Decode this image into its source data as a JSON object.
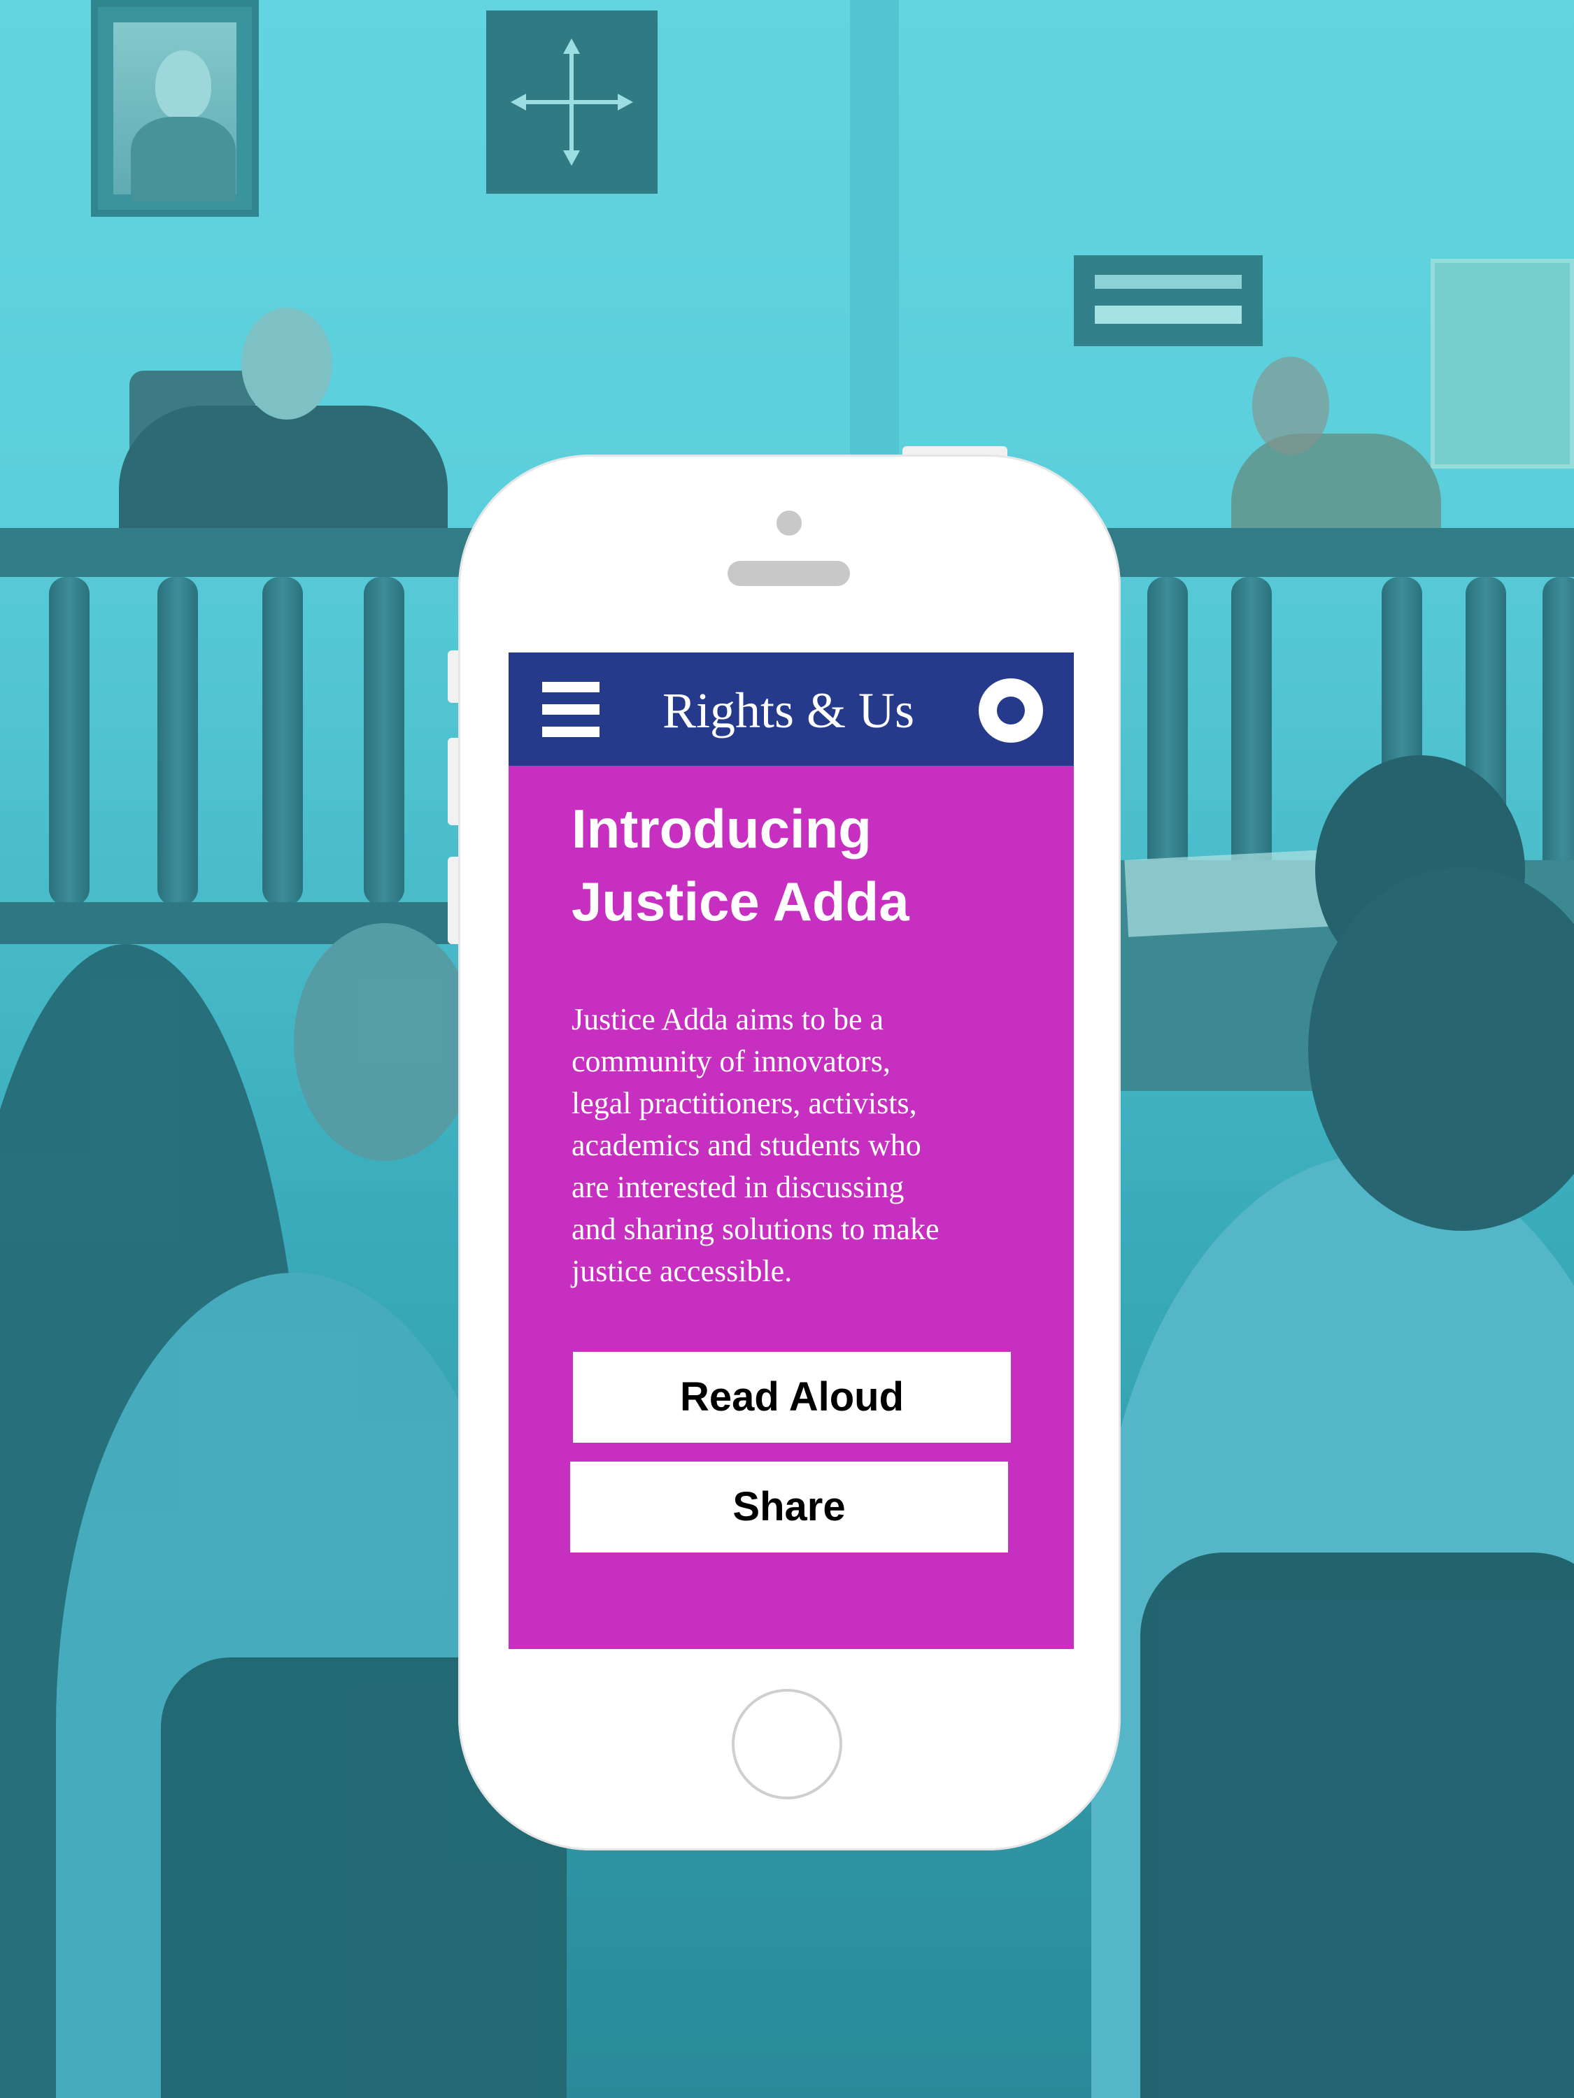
{
  "app": {
    "title": "Rights & Us"
  },
  "header": {
    "menu_icon": "hamburger-menu-icon",
    "action_icon": "record-ring-icon"
  },
  "article": {
    "title_line1": "Introducing",
    "title_line2": "Justice Adda",
    "body_lines": [
      "Justice Adda aims to be a",
      "community of innovators,",
      "legal practitioners, activists,",
      "academics and students who",
      "are interested in discussing",
      "and sharing solutions to make",
      "justice accessible."
    ]
  },
  "actions": {
    "read_aloud_label": "Read Aloud",
    "share_label": "Share"
  },
  "colors": {
    "header_bg": "#263a8c",
    "screen_bg": "#c62fbf",
    "background_tint": "#5fcfdc",
    "button_bg": "#ffffff",
    "text": "#ffffff"
  }
}
